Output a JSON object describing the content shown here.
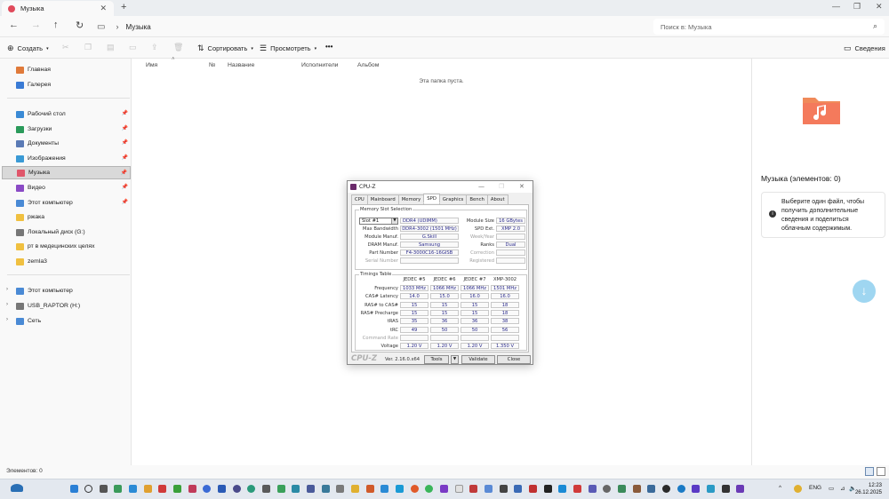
{
  "window": {
    "tab_title": "Музыка",
    "tab_close": "✕",
    "new_tab": "+",
    "controls": [
      "—",
      "❐",
      "✕"
    ]
  },
  "address": {
    "breadcrumb": "Музыка",
    "search_placeholder": "Поиск в: Музыка"
  },
  "toolbar": {
    "create": "Создать",
    "sort": "Сортировать",
    "view": "Просмотреть",
    "more": "•••",
    "details": "Сведения"
  },
  "sidebar": {
    "top": [
      {
        "label": "Главная",
        "color": "#e07a3a"
      },
      {
        "label": "Галерея",
        "color": "#3a7bd5"
      }
    ],
    "quick": [
      {
        "label": "Рабочий стол",
        "color": "#3a8ad5",
        "pin": true
      },
      {
        "label": "Загрузки",
        "color": "#2a9a5a",
        "pin": true
      },
      {
        "label": "Документы",
        "color": "#5a7ab5",
        "pin": true
      },
      {
        "label": "Изображения",
        "color": "#3a9ad5",
        "pin": true
      },
      {
        "label": "Музыка",
        "color": "#e0566a",
        "pin": true,
        "active": true
      },
      {
        "label": "Видео",
        "color": "#8a4ac5",
        "pin": true
      },
      {
        "label": "Этот компьютер",
        "color": "#4a8ad5",
        "pin": true
      },
      {
        "label": "ржака",
        "color": "#f0c040"
      },
      {
        "label": "Локальный диск (G:)",
        "color": "#777777"
      },
      {
        "label": "рт в медецинских целях",
        "color": "#f0c040"
      },
      {
        "label": "zemla3",
        "color": "#f0c040"
      }
    ],
    "tree": [
      {
        "label": "Этот компьютер",
        "color": "#4a8ad5"
      },
      {
        "label": "USB_RAPTOR (H:)",
        "color": "#777777"
      },
      {
        "label": "Сеть",
        "color": "#4a8ad5"
      }
    ]
  },
  "columns": [
    "Имя",
    "№",
    "Название",
    "Исполнители",
    "Альбом"
  ],
  "empty_message": "Эта папка пуста.",
  "details_pane": {
    "title": "Музыка (элементов: 0)",
    "info": "Выберите один файл, чтобы получить дополнительные сведения и поделиться облачным содержимым."
  },
  "status": {
    "items": "Элементов: 0"
  },
  "taskbar": {
    "lang": "ENG",
    "time": "12:23",
    "date": "26.12.2025",
    "tray_arrow": "^"
  },
  "cpuz": {
    "title": "CPU-Z",
    "tabs": [
      "CPU",
      "Mainboard",
      "Memory",
      "SPD",
      "Graphics",
      "Bench",
      "About"
    ],
    "active_tab": "SPD",
    "slot_group": "Memory Slot Selection",
    "slot": "Slot #1",
    "memtype": "DDR4 (UDIMM)",
    "module_size_label": "Module Size",
    "module_size": "16 GBytes",
    "max_bw_label": "Max Bandwidth",
    "max_bw": "DDR4-3002 (1501 MHz)",
    "spd_ext_label": "SPD Ext.",
    "spd_ext": "XMP 2.0",
    "manuf_label": "Module Manuf.",
    "manuf": "G.Skill",
    "weekyear_label": "Week/Year",
    "dram_label": "DRAM Manuf.",
    "dram": "Samsung",
    "ranks_label": "Ranks",
    "ranks": "Dual",
    "part_label": "Part Number",
    "part": "F4-3000C16-16GISB",
    "correction_label": "Correction",
    "serial_label": "Serial Number",
    "registered_label": "Registered",
    "timings_group": "Timings Table",
    "timing_cols": [
      "JEDEC #5",
      "JEDEC #6",
      "JEDEC #7",
      "XMP-3002"
    ],
    "timing_rows": [
      {
        "label": "Frequency",
        "vals": [
          "1033 MHz",
          "1066 MHz",
          "1066 MHz",
          "1501 MHz"
        ]
      },
      {
        "label": "CAS# Latency",
        "vals": [
          "14.0",
          "15.0",
          "16.0",
          "16.0"
        ]
      },
      {
        "label": "RAS# to CAS#",
        "vals": [
          "15",
          "15",
          "15",
          "18"
        ]
      },
      {
        "label": "RAS# Precharge",
        "vals": [
          "15",
          "15",
          "15",
          "18"
        ]
      },
      {
        "label": "tRAS",
        "vals": [
          "35",
          "36",
          "36",
          "38"
        ]
      },
      {
        "label": "tRC",
        "vals": [
          "49",
          "50",
          "50",
          "56"
        ]
      },
      {
        "label": "Command Rate",
        "vals": [
          "",
          "",
          "",
          ""
        ],
        "dim": true
      },
      {
        "label": "Voltage",
        "vals": [
          "1.20 V",
          "1.20 V",
          "1.20 V",
          "1.350 V"
        ]
      }
    ],
    "brand": "CPU-Z",
    "version": "Ver. 2.16.0.x64",
    "tools": "Tools",
    "validate": "Validate",
    "close": "Close"
  }
}
